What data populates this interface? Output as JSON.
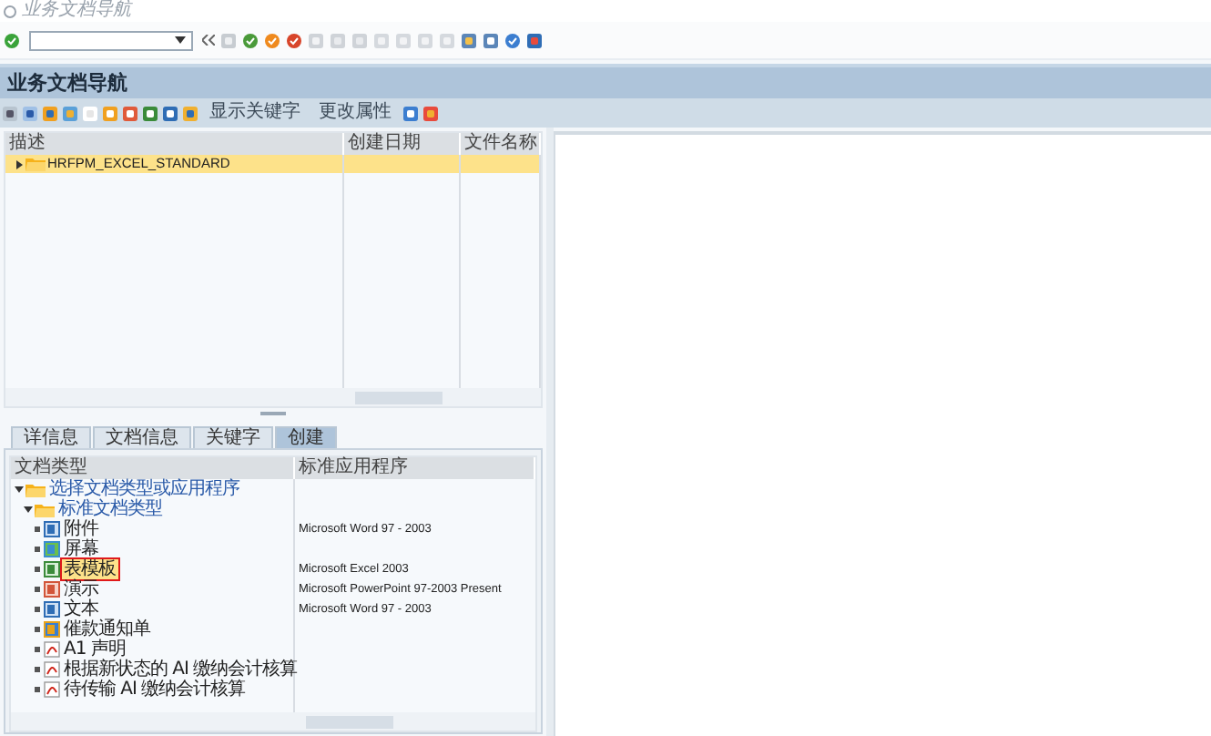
{
  "title_bar": {
    "title": "业务文档导航"
  },
  "screen_title": "业务文档导航",
  "toolbar_buttons": [
    "显示关键字",
    "更改属性"
  ],
  "object_tree": {
    "columns": [
      "描述",
      "创建日期",
      "文件名称"
    ],
    "nodes": [
      {
        "label": "HRFPM_EXCEL_STANDARD",
        "selected": true,
        "expanded": false
      }
    ]
  },
  "tabs": [
    {
      "label": "详信息",
      "selected": false
    },
    {
      "label": "文档信息",
      "selected": false
    },
    {
      "label": "关键字",
      "selected": false
    },
    {
      "label": "创建",
      "selected": true
    }
  ],
  "create_tree": {
    "columns": [
      "文档类型",
      "标准应用程序"
    ],
    "nodes": [
      {
        "label": "选择文档类型或应用程序",
        "kind": "folder",
        "expanded": true,
        "selected": false,
        "children": [
          {
            "label": "标准文档类型",
            "kind": "folder",
            "expanded": true,
            "selected": false,
            "children": [
              {
                "label": "附件",
                "kind": "word",
                "application": "Microsoft Word 97 - 2003",
                "selected": false
              },
              {
                "label": "屏幕",
                "kind": "image",
                "selected": false
              },
              {
                "label": "表模板",
                "kind": "excel",
                "application": "Microsoft Excel 2003",
                "selected": true
              },
              {
                "label": "演示",
                "kind": "ppt",
                "application": "Microsoft PowerPoint 97-2003 Present",
                "selected": false
              },
              {
                "label": "文本",
                "kind": "word",
                "application": "Microsoft Word 97 - 2003",
                "selected": false
              },
              {
                "label": "催款通知单",
                "kind": "form",
                "selected": false
              },
              {
                "label": "A1 声明",
                "kind": "pdf",
                "selected": false
              },
              {
                "label": "根据新状态的 AI 缴纳会计核算",
                "kind": "pdf",
                "selected": false
              },
              {
                "label": "待传输 AI 缴纳会计核算",
                "kind": "pdf",
                "selected": false
              }
            ]
          }
        ]
      }
    ]
  }
}
